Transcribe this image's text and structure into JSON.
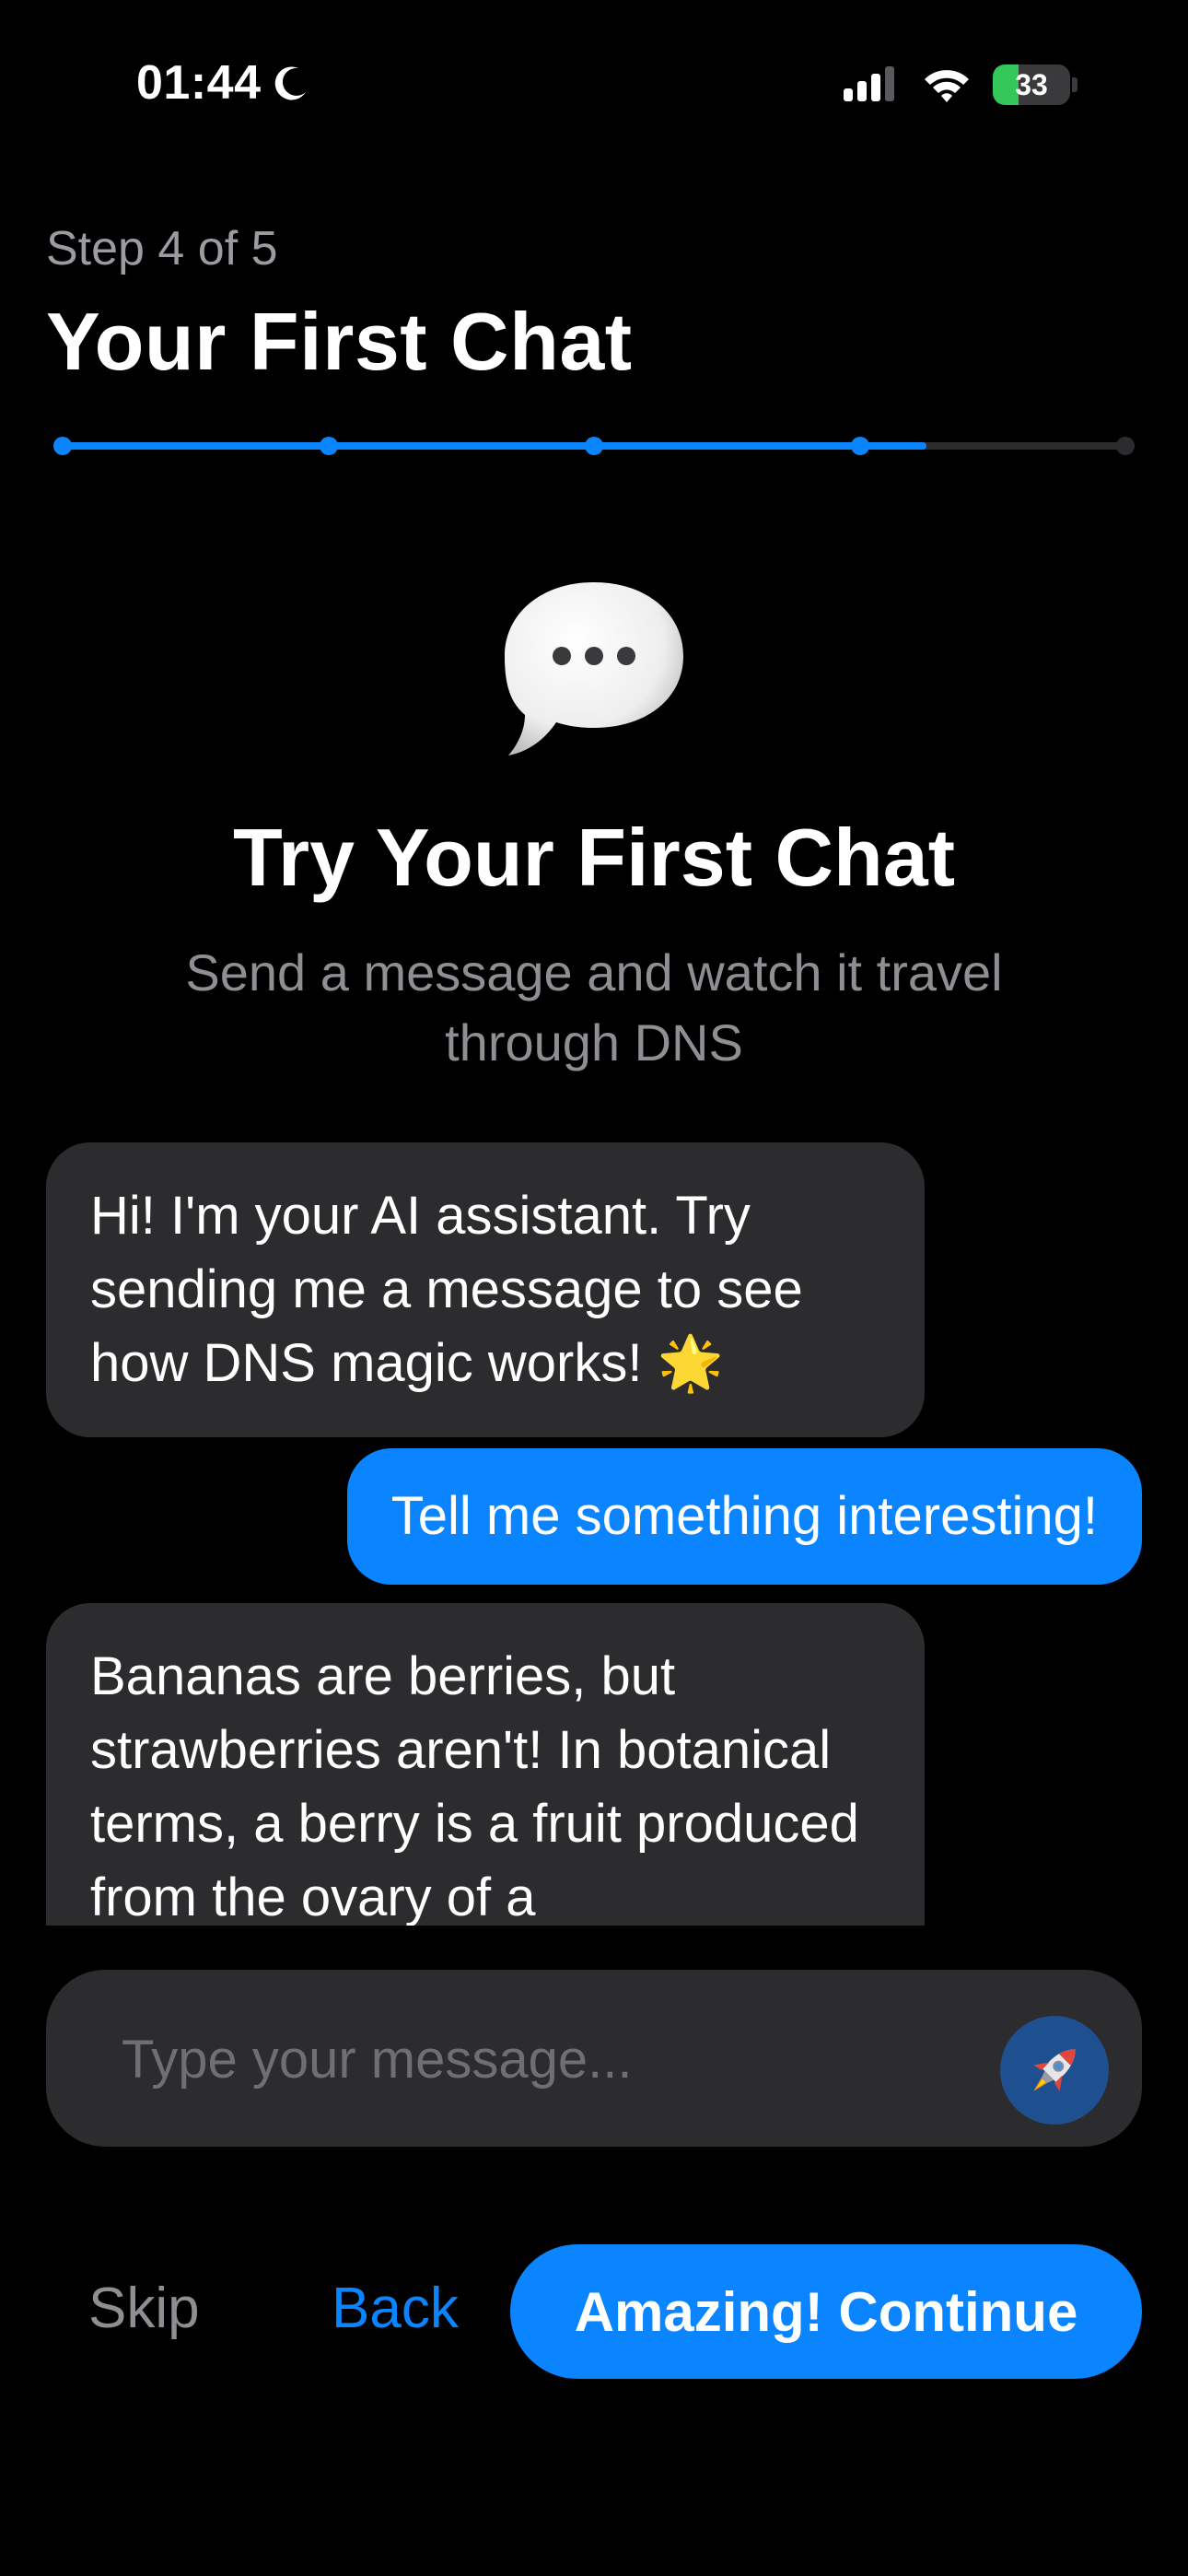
{
  "status_bar": {
    "time": "01:44",
    "moon_icon": "moon-icon",
    "signal_icon": "cellular-signal-icon",
    "wifi_icon": "wifi-icon",
    "battery_level": "33",
    "battery_fraction": 0.33,
    "battery_color": "#34c759"
  },
  "header": {
    "step_label": "Step 4 of 5",
    "title": "Your First Chat",
    "progress": {
      "current_step": 4,
      "total_steps": 5,
      "active_color": "#0a84ff",
      "inactive_color": "#2c2c2e"
    }
  },
  "intro": {
    "icon": "speech-bubble-icon",
    "title": "Try Your First Chat",
    "subtitle": "Send a message and watch it travel through DNS"
  },
  "messages": [
    {
      "role": "assistant",
      "text": "Hi! I'm your AI assistant. Try sending me a message to see how DNS magic works! 🌟"
    },
    {
      "role": "user",
      "text": "Tell me something interesting!"
    },
    {
      "role": "assistant",
      "text": "Bananas are berries, but strawberries aren't! In botanical terms, a berry is a fruit produced from the ovary of a"
    }
  ],
  "composer": {
    "placeholder": "Type your message...",
    "value": "",
    "send_icon": "rocket-icon"
  },
  "actions": {
    "skip_label": "Skip",
    "back_label": "Back",
    "continue_label": "Amazing! Continue"
  },
  "colors": {
    "background": "#000000",
    "accent": "#0a84ff",
    "bubble_assistant": "#2c2c2e",
    "secondary_text": "#8e8e93"
  }
}
